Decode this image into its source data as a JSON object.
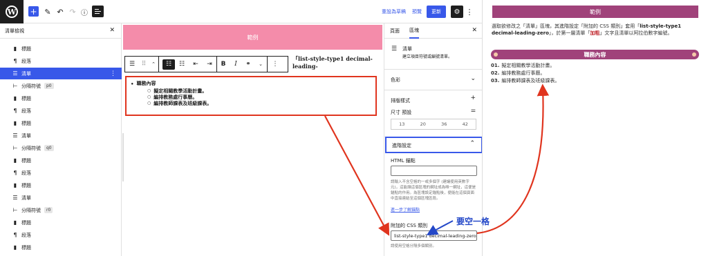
{
  "topbar": {
    "revert_label": "重設為草稿",
    "preview_label": "預覽",
    "publish_label": "更新"
  },
  "list_view": {
    "title": "清單檢視",
    "items": [
      {
        "icon": "bookmark-icon",
        "label": "標題",
        "badge": ""
      },
      {
        "icon": "paragraph-icon",
        "label": "段落",
        "badge": ""
      },
      {
        "icon": "list-icon",
        "label": "清單",
        "badge": "",
        "selected": true
      },
      {
        "icon": "separator-icon",
        "label": "分隔符號",
        "badge": "p0"
      },
      {
        "icon": "bookmark-icon",
        "label": "標題",
        "badge": ""
      },
      {
        "icon": "paragraph-icon",
        "label": "段落",
        "badge": ""
      },
      {
        "icon": "bookmark-icon",
        "label": "標題",
        "badge": ""
      },
      {
        "icon": "list-icon",
        "label": "清單",
        "badge": ""
      },
      {
        "icon": "separator-icon",
        "label": "分隔符號",
        "badge": "q0"
      },
      {
        "icon": "bookmark-icon",
        "label": "標題",
        "badge": ""
      },
      {
        "icon": "paragraph-icon",
        "label": "段落",
        "badge": ""
      },
      {
        "icon": "bookmark-icon",
        "label": "標題",
        "badge": ""
      },
      {
        "icon": "list-icon",
        "label": "清單",
        "badge": ""
      },
      {
        "icon": "separator-icon",
        "label": "分隔符號",
        "badge": "r0"
      },
      {
        "icon": "bookmark-icon",
        "label": "標題",
        "badge": ""
      },
      {
        "icon": "paragraph-icon",
        "label": "段落",
        "badge": ""
      },
      {
        "icon": "bookmark-icon",
        "label": "標題",
        "badge": ""
      }
    ]
  },
  "canvas": {
    "banner": "範例",
    "heading_fragment": "「list-style-type1 decimal-leading-",
    "list_outer": "職務內容",
    "list_inner": [
      "擬定相關教學活動計畫。",
      "編排教務處行事曆。",
      "編排教師課表及班級課表。"
    ]
  },
  "sidebar": {
    "tab_page": "頁面",
    "tab_block": "區塊",
    "block_name": "清單",
    "block_desc": "建立項目符號或編號清單。",
    "color_label": "色彩",
    "typography_label": "排版樣式",
    "size_label": "尺寸 預設",
    "sizes": [
      "13",
      "20",
      "36",
      "42"
    ],
    "advanced_label": "進階設定",
    "html_anchor_label": "HTML 錨點",
    "html_anchor_value": "",
    "anchor_help": "請輸入不含空格的一或多個字 (建議使用英數字元)，這能讓這個區塊的網址成為唯一網址，這便是錨點的作用。為區塊設定錨點後，便能在這個頁面中直接連結至這個區塊區段。",
    "learn_more": "進一步了解錨點",
    "css_class_label": "附加的 CSS 類別",
    "css_class_value": "list-style-type1 decimal-leading-zero",
    "css_help": "請使用空格分隔多個類別。"
  },
  "preview": {
    "banner": "範例",
    "intro_1": "選取欲修改之「清單」區塊，其進階設定「附加的 CSS 類別」套用「",
    "intro_bold": "list-style-type1 decimal-leading-zero",
    "intro_2": "」，於第一層清單「",
    "intro_red": "加粗",
    "intro_3": "」文字且清單以阿拉伯數字編號。",
    "pill_title": "職務內容",
    "items": [
      {
        "num": "01.",
        "text": "擬定相關教學活動計畫。"
      },
      {
        "num": "02.",
        "text": "編排教務處行事曆。"
      },
      {
        "num": "03.",
        "text": "編排教師課表及班級課表。"
      }
    ]
  },
  "annotation": {
    "callout": "要空一格"
  },
  "colors": {
    "accent": "#3858e9",
    "canvas_banner": "#f48caa",
    "preview_banner": "#a0427a",
    "arrow": "#e0341e",
    "callout": "#2448c8"
  }
}
